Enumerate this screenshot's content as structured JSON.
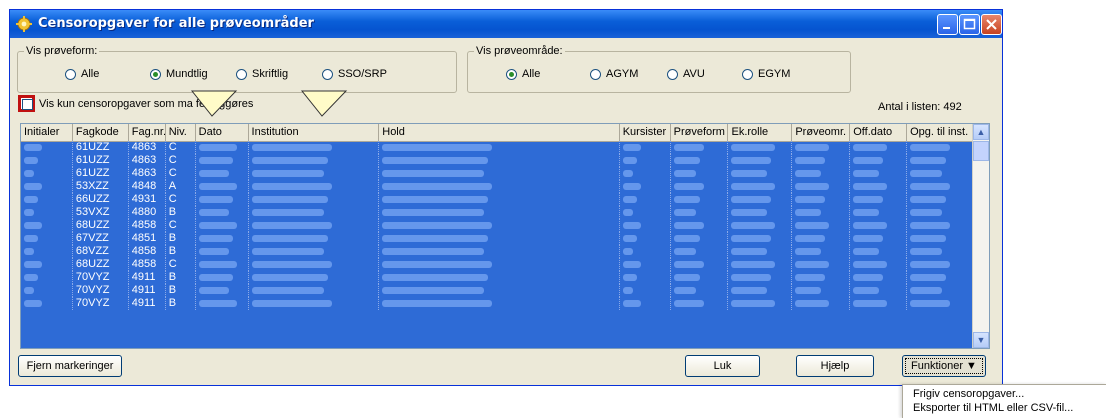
{
  "window": {
    "title": "Censoropgaver for alle prøveområder"
  },
  "proeveform": {
    "legend": "Vis prøveform:",
    "options": [
      "Alle",
      "Mundtlig",
      "Skriftlig",
      "SSO/SRP"
    ],
    "selected": "Mundtlig"
  },
  "proeveomraade": {
    "legend": "Vis prøveområde:",
    "options": [
      "Alle",
      "AGYM",
      "AVU",
      "EGYM"
    ],
    "selected": "Alle"
  },
  "filter_checkbox": {
    "label": "Vis kun censoropgaver som ma    fentliggøres",
    "checked": false
  },
  "count_label": "Antal i listen: 492",
  "grid": {
    "columns": [
      "Initialer",
      "Fagkode",
      "Fag.nr.",
      "Niv.",
      "Dato",
      "Institution",
      "Hold",
      "Kursister",
      "Prøveform",
      "Ek.rolle",
      "Prøveomr.",
      "Off.dato",
      "Opg. til inst."
    ],
    "rows": [
      [
        "61UZZ",
        "4863",
        "C"
      ],
      [
        "61UZZ",
        "4863",
        "C"
      ],
      [
        "61UZZ",
        "4863",
        "C"
      ],
      [
        "53XZZ",
        "4848",
        "A"
      ],
      [
        "66UZZ",
        "4931",
        "C"
      ],
      [
        "53VXZ",
        "4880",
        "B"
      ],
      [
        "68UZZ",
        "4858",
        "C"
      ],
      [
        "67VZZ",
        "4851",
        "B"
      ],
      [
        "68VZZ",
        "4858",
        "B"
      ],
      [
        "68UZZ",
        "4858",
        "C"
      ],
      [
        "70VYZ",
        "4911",
        "B"
      ],
      [
        "70VYZ",
        "4911",
        "B"
      ],
      [
        "70VYZ",
        "4911",
        "B"
      ]
    ]
  },
  "buttons": {
    "clear": "Fjern markeringer",
    "close": "Luk",
    "help": "Hjælp",
    "functions": "Funktioner ▼"
  },
  "functions_menu": {
    "items": [
      "Frigiv censoropgaver...",
      "Eksporter til HTML eller CSV-fil..."
    ]
  },
  "colors": {
    "title_bar": "#0a5fd8",
    "selection": "#2e6bd6",
    "highlight_box": "#c01010",
    "callout": "#fffbc8"
  }
}
